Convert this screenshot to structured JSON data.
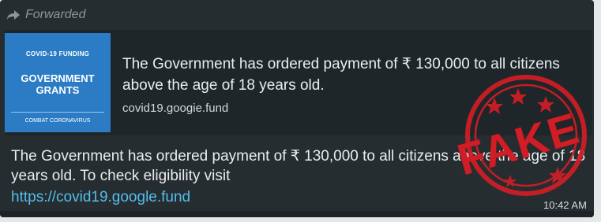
{
  "forwarded": {
    "label": "Forwarded",
    "icon": "forward-arrow-icon"
  },
  "preview": {
    "thumbnail": {
      "top_label": "COVID-19 FUNDING",
      "title": "GOVERNMENT GRANTS",
      "bottom_label": "COMBAT CORONAVIRUS",
      "color": "#2b7cc4"
    },
    "title": "The Government has ordered payment of ₹ 130,000 to all citizens above the age of 18 years old.",
    "domain": "covid19.googie.fund"
  },
  "message": {
    "text": "The Government has ordered payment of ₹ 130,000 to all citizens above the age of 18 years old. To check eligibility visit",
    "link": "https://covid19.google.fund",
    "time": "10:42 AM"
  },
  "stamp": {
    "text": "FAKE",
    "color": "#d01d26"
  }
}
